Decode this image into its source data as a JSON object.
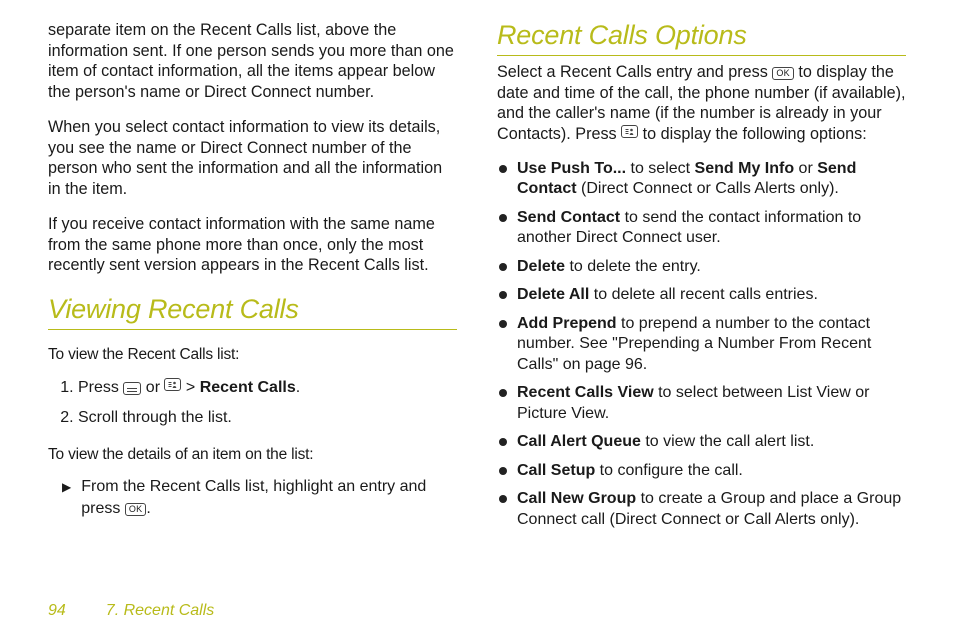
{
  "left": {
    "p1": "separate item on the Recent Calls list, above the information sent. If one person sends you more than one item of contact information, all the items appear below the person's name or Direct Connect number.",
    "p2": "When you select contact information to view its details, you see the name or Direct Connect number of the person who sent the information and all the information in the item.",
    "p3": "If you receive contact information with the same name from the same phone more than once, only the most recently sent version appears in the Recent Calls list.",
    "h_view": "Viewing Recent Calls",
    "lead_view": "To view the Recent Calls list:",
    "step1_a": "Press ",
    "step1_b": " or ",
    "step1_c": " > ",
    "step1_bold": "Recent Calls",
    "step1_d": ".",
    "step2": "Scroll through the list.",
    "lead_details": "To view the details of an item on the list:",
    "tri_a": "From the Recent Calls list, highlight an entry and press ",
    "tri_b": "."
  },
  "right": {
    "h_opts": "Recent Calls Options",
    "intro_a": "Select a Recent Calls entry and press ",
    "intro_b": " to display the date and time of the call, the phone number (if available), and the caller's name (if the number is already in your Contacts). Press ",
    "intro_c": " to display the following options:",
    "items": [
      {
        "bold": "Use Push To...",
        "rest_a": " to select ",
        "bold2": "Send My Info",
        "mid": " or ",
        "bold3": "Send Contact",
        "rest_b": " (Direct Connect or Calls Alerts only)."
      },
      {
        "bold": "Send Contact",
        "rest": " to send the contact information to another Direct Connect user."
      },
      {
        "bold": "Delete",
        "rest": " to delete the entry."
      },
      {
        "bold": "Delete All",
        "rest": " to delete all recent calls entries."
      },
      {
        "bold": "Add Prepend",
        "rest": " to prepend a number to the contact number. See \"Prepending a Number From Recent Calls\" on page 96."
      },
      {
        "bold": "Recent Calls View",
        "rest": " to select between List View or Picture View."
      },
      {
        "bold": "Call Alert Queue",
        "rest": " to view the call alert list."
      },
      {
        "bold": "Call Setup",
        "rest": " to configure the call."
      },
      {
        "bold": "Call New Group",
        "rest": " to create a Group and place a Group Connect call (Direct Connect or Call Alerts only)."
      }
    ]
  },
  "footer": {
    "pagenum": "94",
    "chapter": "7. Recent Calls"
  },
  "keys": {
    "ok": "OK"
  }
}
